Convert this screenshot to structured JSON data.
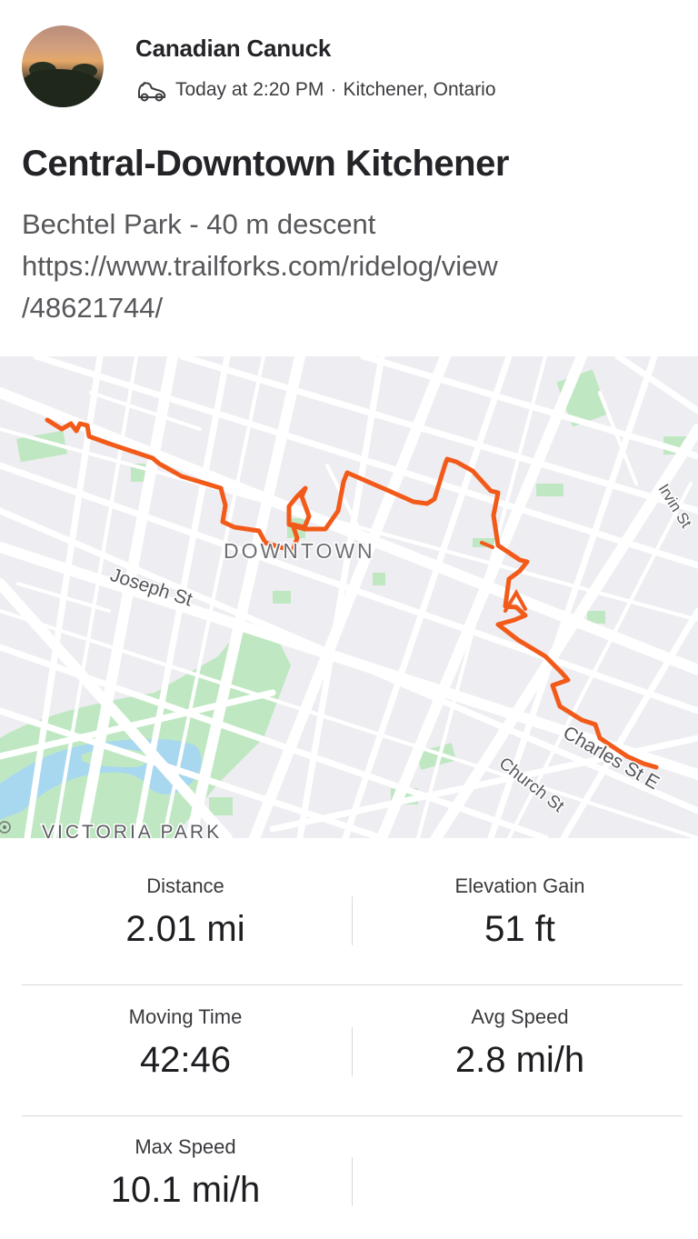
{
  "header": {
    "user_name": "Canadian Canuck",
    "icon": "bike-icon",
    "timestamp": "Today at 2:20 PM",
    "separator": "·",
    "location": "Kitchener, Ontario"
  },
  "activity": {
    "title": "Central-Downtown Kitchener",
    "description_line1": "Bechtel Park - 40 m descent",
    "description_line2": "https://www.trailforks.com/ridelog/view",
    "description_line3": "/48621744/"
  },
  "map": {
    "labels": {
      "downtown": "DOWNTOWN",
      "joseph": "Joseph St",
      "charles": "Charles St E",
      "church": "Church St",
      "irvin": "Irvin St",
      "victoria": "VICTORIA PARK"
    },
    "colors": {
      "route": "#f25a1a",
      "park": "#bfe8c2",
      "water": "#a8d8f0",
      "road": "#ffffff",
      "land": "#eeedf1"
    }
  },
  "stats": {
    "distance": {
      "label": "Distance",
      "value": "2.01 mi"
    },
    "elevation": {
      "label": "Elevation Gain",
      "value": "51 ft"
    },
    "moving_time": {
      "label": "Moving Time",
      "value": "42:46"
    },
    "avg_speed": {
      "label": "Avg Speed",
      "value": "2.8 mi/h"
    },
    "max_speed": {
      "label": "Max Speed",
      "value": "10.1 mi/h"
    }
  }
}
